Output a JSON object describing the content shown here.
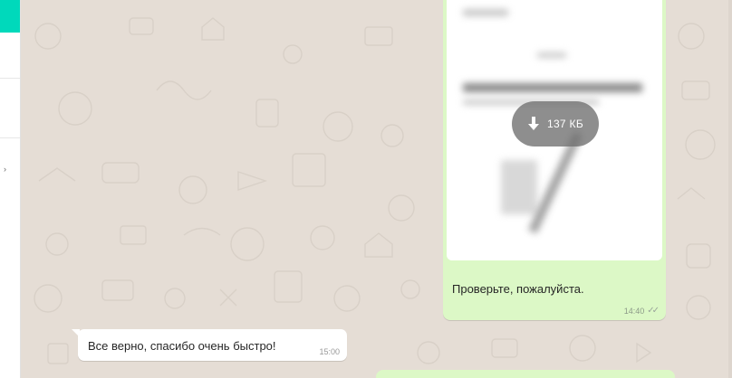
{
  "sidebar": {
    "accent_color": "#00d9bb",
    "mark": "›"
  },
  "chat": {
    "wallpaper_color": "#e5ddd5",
    "outgoing_color": "#dcf8c6",
    "incoming_color": "#ffffff"
  },
  "messages": [
    {
      "direction": "outgoing",
      "type": "document",
      "download_size": "137 КБ",
      "download_icon": "download-arrow-icon",
      "caption": "Проверьте, пожалуйста.",
      "time": "14:40",
      "status_icon": "double-check-icon",
      "status_glyph": "✓✓"
    },
    {
      "direction": "incoming",
      "type": "text",
      "text": "Все верно, спасибо очень быстро!",
      "time": "15:00"
    }
  ]
}
